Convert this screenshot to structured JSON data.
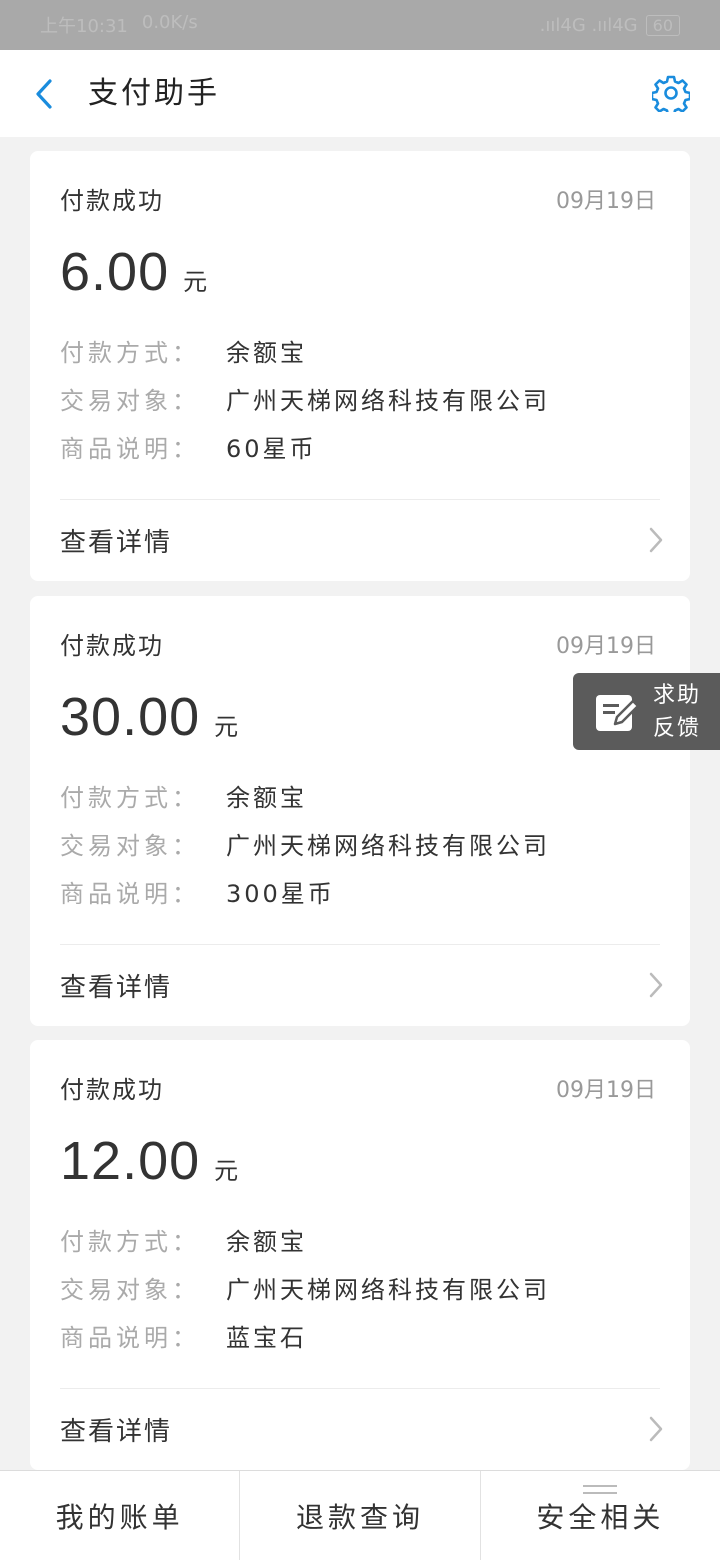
{
  "status_bar": {
    "time": "上午10:31",
    "speed": "0.0K/s",
    "signal": ".ııl4G .ııl4G",
    "battery": "60"
  },
  "nav": {
    "title": "支付助手"
  },
  "labels": {
    "method": "付款方式：",
    "counterparty": "交易对象：",
    "description": "商品说明：",
    "unit": "元",
    "view_detail": "查看详情"
  },
  "cards": [
    {
      "status": "付款成功",
      "date": "09月19日",
      "amount": "6.00",
      "method": "余额宝",
      "counterparty": "广州天梯网络科技有限公司",
      "description": "60星币"
    },
    {
      "status": "付款成功",
      "date": "09月19日",
      "amount": "30.00",
      "method": "余额宝",
      "counterparty": "广州天梯网络科技有限公司",
      "description": "300星币"
    },
    {
      "status": "付款成功",
      "date": "09月19日",
      "amount": "12.00",
      "method": "余额宝",
      "counterparty": "广州天梯网络科技有限公司",
      "description": "蓝宝石"
    }
  ],
  "float_help": {
    "line1": "求助",
    "line2": "反馈",
    "icon": "edit-icon"
  },
  "tabs": [
    {
      "label": "我的账单"
    },
    {
      "label": "退款查询"
    },
    {
      "label": "安全相关",
      "icon": "menu-icon"
    }
  ],
  "colors": {
    "accent": "#1a8cdd",
    "background": "#f2f2f2",
    "status_bar": "#a9a9a9",
    "float_help": "#5b5b5b"
  }
}
